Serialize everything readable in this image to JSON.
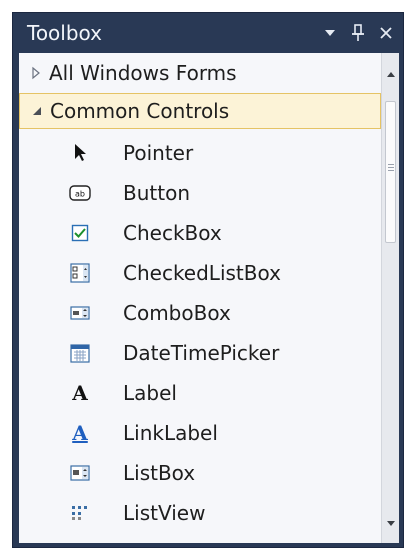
{
  "window": {
    "title": "Toolbox",
    "dropdown_glyph": "▾",
    "pin_glyph": "⊥",
    "close_glyph": "✕"
  },
  "categories": [
    {
      "label": "All Windows Forms",
      "expanded": false,
      "icon": "chevron-right-icon"
    },
    {
      "label": "Common Controls",
      "expanded": true,
      "icon": "triangle-down-icon"
    }
  ],
  "items": [
    {
      "label": "Pointer",
      "icon": "pointer-icon"
    },
    {
      "label": "Button",
      "icon": "button-icon"
    },
    {
      "label": "CheckBox",
      "icon": "checkbox-icon"
    },
    {
      "label": "CheckedListBox",
      "icon": "checkedlistbox-icon"
    },
    {
      "label": "ComboBox",
      "icon": "combobox-icon"
    },
    {
      "label": "DateTimePicker",
      "icon": "datetimepicker-icon"
    },
    {
      "label": "Label",
      "icon": "label-icon"
    },
    {
      "label": "LinkLabel",
      "icon": "linklabel-icon"
    },
    {
      "label": "ListBox",
      "icon": "listbox-icon"
    },
    {
      "label": "ListView",
      "icon": "listview-icon"
    }
  ],
  "colors": {
    "frame": "#293955",
    "panel": "#f6f7fa",
    "selection": "#fcf3d7",
    "selection_border": "#e5c365",
    "link_blue": "#1f5fbf"
  }
}
